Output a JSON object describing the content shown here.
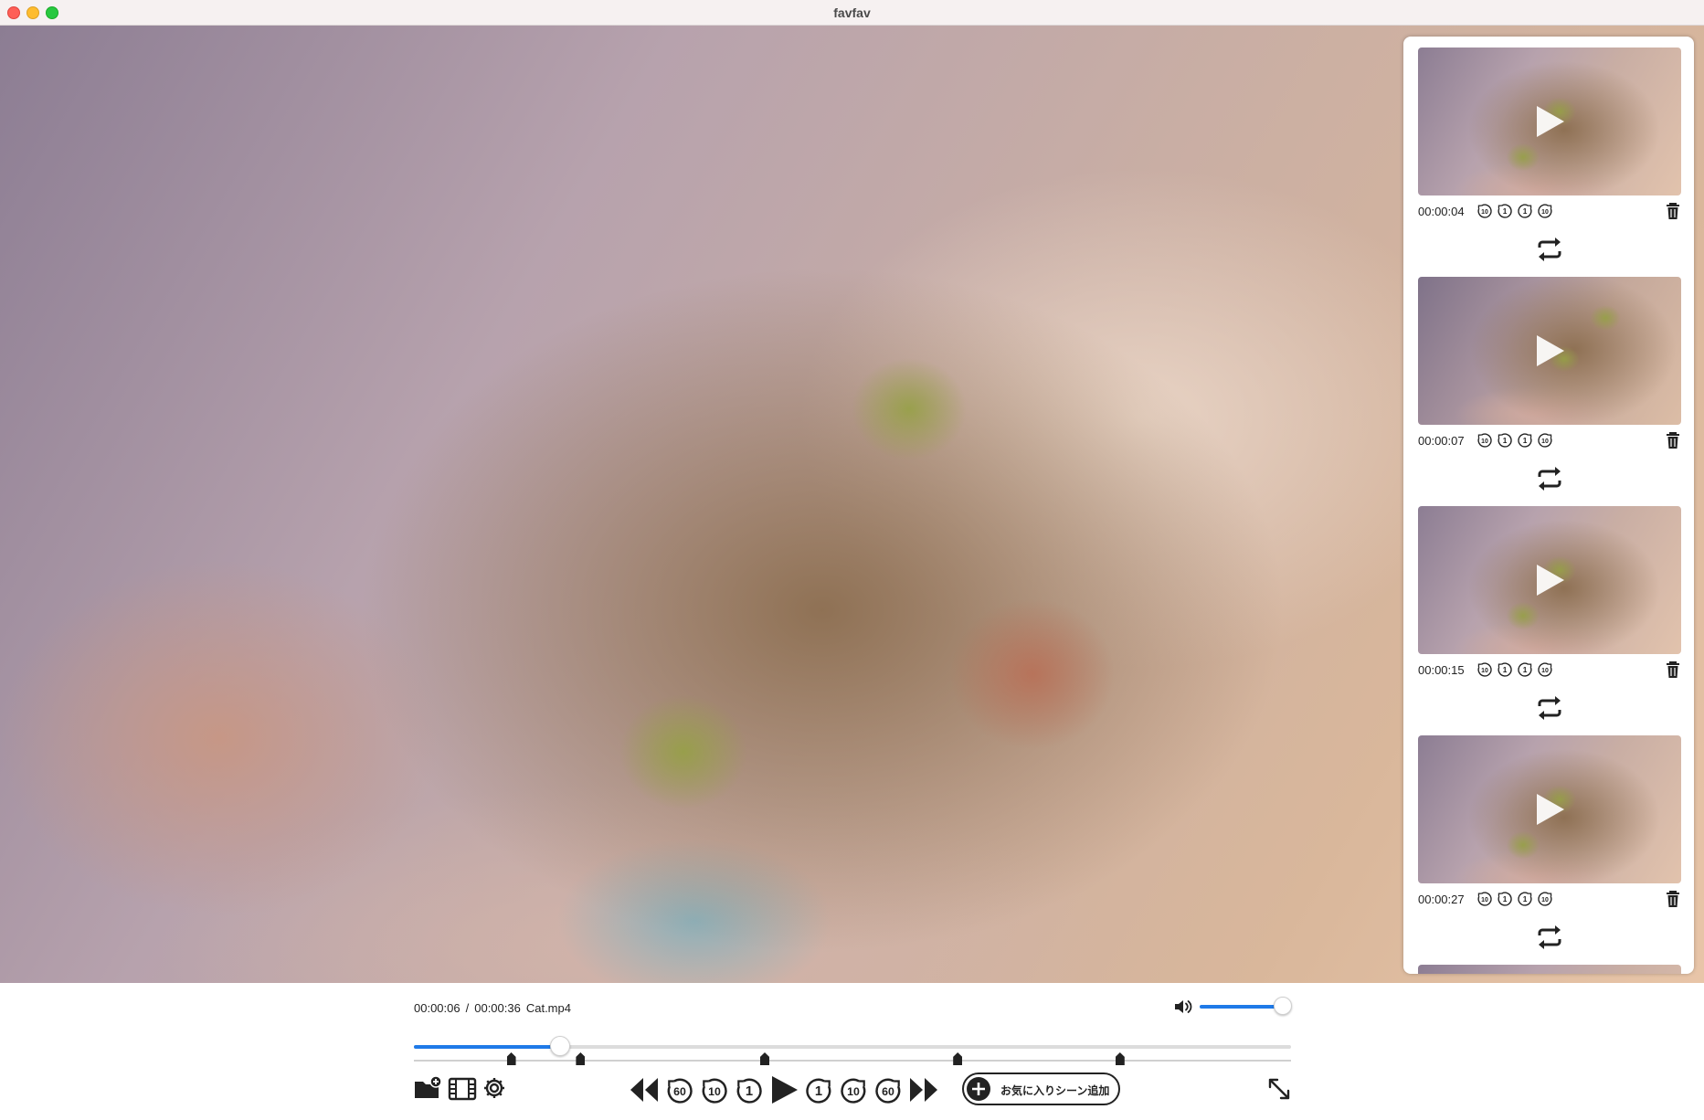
{
  "window": {
    "title": "favfav"
  },
  "player": {
    "current_time": "00:00:06",
    "separator": "/",
    "duration": "00:00:36",
    "filename": "Cat.mp4",
    "progress_fraction": 0.167,
    "volume_fraction": 0.98,
    "marker_positions_fraction": [
      0.111,
      0.19,
      0.4,
      0.62,
      0.805
    ]
  },
  "scenes": [
    {
      "time": "00:00:04",
      "thumb": "cat-looking"
    },
    {
      "time": "00:00:07",
      "thumb": "cat-turned"
    },
    {
      "time": "00:00:15",
      "thumb": "cat-looking"
    },
    {
      "time": "00:00:27",
      "thumb": "cat-looking"
    }
  ],
  "scene_seek_labels": [
    "10",
    "1",
    "1",
    "10"
  ],
  "controls": {
    "seek_back_labels": [
      "60",
      "10",
      "1"
    ],
    "seek_forward_labels": [
      "1",
      "10",
      "60"
    ],
    "add_favorite_label": "お気に入りシーン追加"
  },
  "icons": {
    "open_folder": "folder-plus-icon",
    "film": "film-strip-icon",
    "settings": "gear-icon",
    "volume": "speaker-icon",
    "expand": "expand-arrows-icon",
    "loop": "repeat-icon",
    "trash": "trash-icon"
  },
  "colors": {
    "accent": "#1f7ae8",
    "icon": "#222222"
  }
}
